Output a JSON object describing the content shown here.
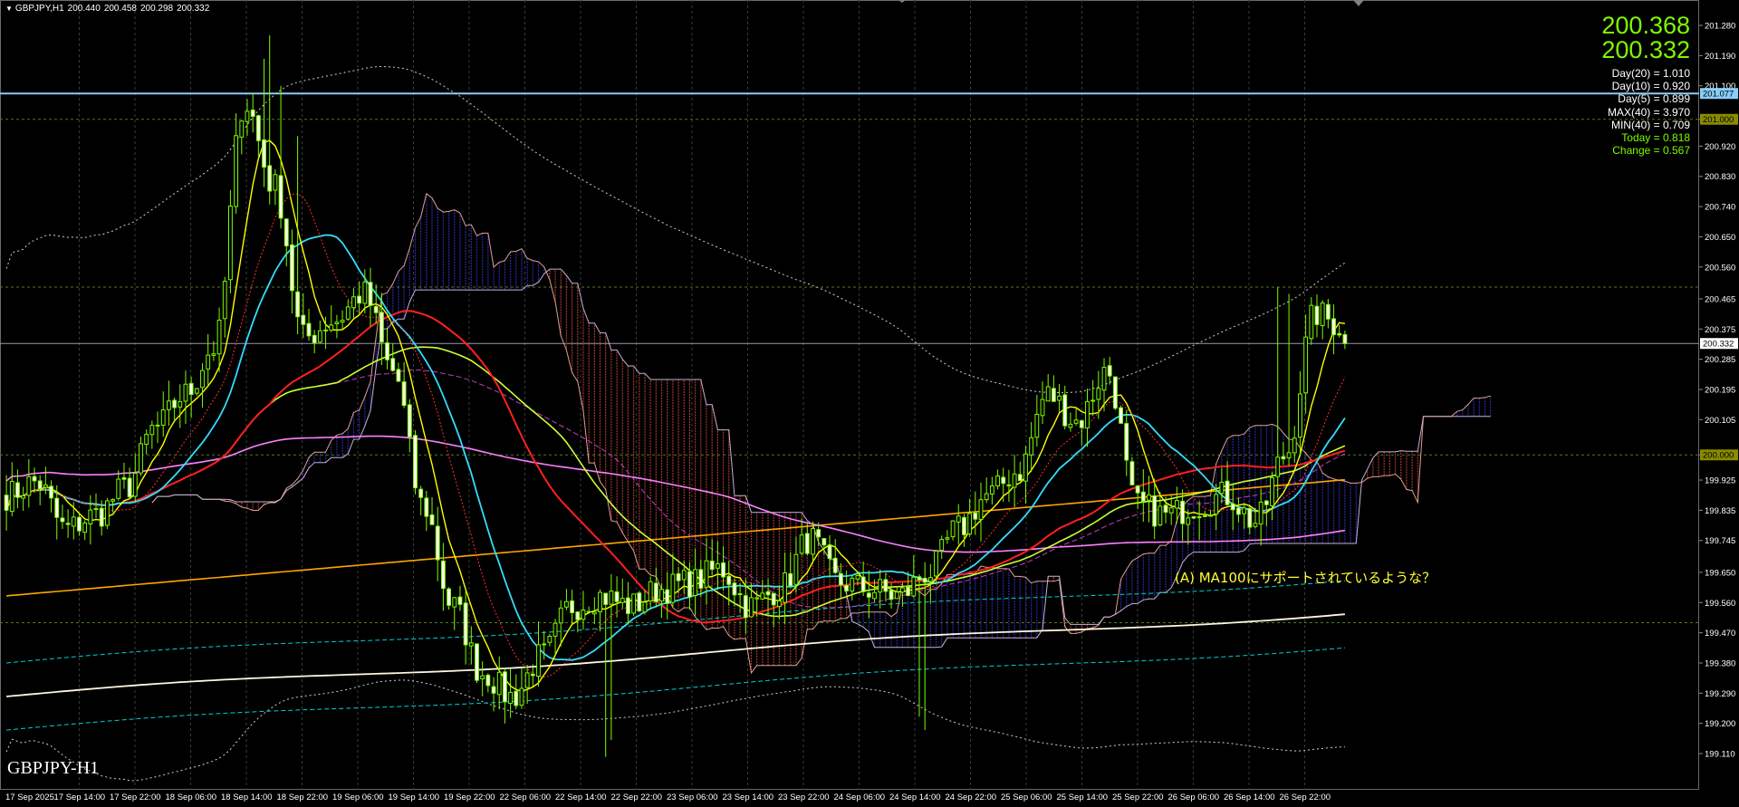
{
  "header": {
    "symbol_tf": "GBPJPY,H1",
    "open": "200.440",
    "high": "200.458",
    "low": "200.298",
    "close": "200.332"
  },
  "info": {
    "bid_big": "200.368",
    "ask_big": "200.332",
    "stats": [
      {
        "text": "Day(20) = 1.010",
        "color": "#ffffff"
      },
      {
        "text": "Day(10) = 0.920",
        "color": "#ffffff"
      },
      {
        "text": "Day(5) = 0.899",
        "color": "#ffffff"
      },
      {
        "text": "MAX(40) = 3.970",
        "color": "#ffffff"
      },
      {
        "text": "MIN(40) = 0.709",
        "color": "#ffffff"
      },
      {
        "text": "Today = 0.818",
        "color": "#7cfc00"
      },
      {
        "text": "Change = 0.567",
        "color": "#7cfc00"
      }
    ]
  },
  "symbol_label": "GBPJPY-H1",
  "annotation": "(A)  MA100にサポートされているような？",
  "colors": {
    "background": "#000000",
    "bull": "#7cfc00",
    "bear": "#ffffff",
    "grid": "#3a3a3a",
    "hline": "#87cefa",
    "cloud_bull": "#2a2aa0",
    "cloud_bear": "#a03a2a"
  },
  "chart_data": {
    "type": "candlestick",
    "symbol": "GBPJPY",
    "timeframe": "H1",
    "y_ticks": [
      201.28,
      201.19,
      201.1,
      201.0,
      200.92,
      200.83,
      200.74,
      200.65,
      200.56,
      200.465,
      200.375,
      200.285,
      200.195,
      200.105,
      200.0,
      199.925,
      199.835,
      199.745,
      199.65,
      199.56,
      199.47,
      199.38,
      199.29,
      199.2,
      199.11
    ],
    "y_tick_labels": [
      "201.280",
      "201.190",
      "201.100",
      "201.010",
      "200.920",
      "200.830",
      "200.740",
      "200.650",
      "200.560",
      "200.465",
      "200.375",
      "200.285",
      "200.195",
      "200.105",
      "200.015",
      "199.925",
      "199.835",
      "199.745",
      "199.650",
      "199.560",
      "199.470",
      "199.380",
      "199.290",
      "199.200",
      "199.110"
    ],
    "ylim": [
      199.06,
      201.35
    ],
    "x_labels": [
      "17 Sep 2025",
      "17 Sep 14:00",
      "17 Sep 22:00",
      "18 Sep 06:00",
      "18 Sep 14:00",
      "18 Sep 22:00",
      "19 Sep 06:00",
      "19 Sep 14:00",
      "19 Sep 22:00",
      "22 Sep 06:00",
      "22 Sep 14:00",
      "22 Sep 22:00",
      "23 Sep 06:00",
      "23 Sep 14:00",
      "23 Sep 22:00",
      "24 Sep 06:00",
      "24 Sep 14:00",
      "24 Sep 22:00",
      "25 Sep 06:00",
      "25 Sep 14:00",
      "25 Sep 22:00",
      "26 Sep 06:00",
      "26 Sep 14:00",
      "26 Sep 22:00"
    ],
    "price_tags": [
      {
        "value": 201.077,
        "label": "201.077",
        "bg": "#87cefa",
        "fg": "#000000"
      },
      {
        "value": 201.0,
        "label": "201.000",
        "bg": "#8a8a00",
        "fg": "#000000"
      },
      {
        "value": 200.332,
        "label": "200.332",
        "bg": "#ffffff",
        "fg": "#000000"
      },
      {
        "value": 200.0,
        "label": "200.000",
        "bg": "#8a8a00",
        "fg": "#000000"
      }
    ],
    "hlines": [
      {
        "value": 201.077,
        "style": "solid",
        "color": "#87cefa",
        "width": 2
      },
      {
        "value": 201.0,
        "style": "dash",
        "color": "#4a7a2a",
        "width": 1
      },
      {
        "value": 200.5,
        "style": "dash",
        "color": "#4a7a2a",
        "width": 1
      },
      {
        "value": 200.332,
        "style": "solid",
        "color": "#9a9ab0",
        "width": 1
      },
      {
        "value": 200.0,
        "style": "dash",
        "color": "#4a7a2a",
        "width": 1
      },
      {
        "value": 199.5,
        "style": "dash",
        "color": "#4a7a2a",
        "width": 1
      }
    ],
    "close_anchors": [
      199.88,
      199.92,
      199.78,
      199.82,
      199.9,
      200.08,
      200.18,
      200.32,
      201.05,
      200.8,
      200.35,
      200.4,
      200.48,
      200.25,
      199.85,
      199.55,
      199.35,
      199.28,
      199.4,
      199.55,
      199.58,
      199.55,
      199.6,
      199.62,
      199.66,
      199.55,
      199.6,
      199.75,
      199.62,
      199.6,
      199.58,
      199.65,
      199.78,
      199.88,
      199.95,
      200.18,
      200.1,
      200.25,
      199.85,
      199.82,
      199.85,
      199.88,
      199.8,
      200.0,
      200.42,
      200.38
    ],
    "price_range": {
      "high": 201.25,
      "low": 199.1,
      "last": 200.332
    }
  }
}
